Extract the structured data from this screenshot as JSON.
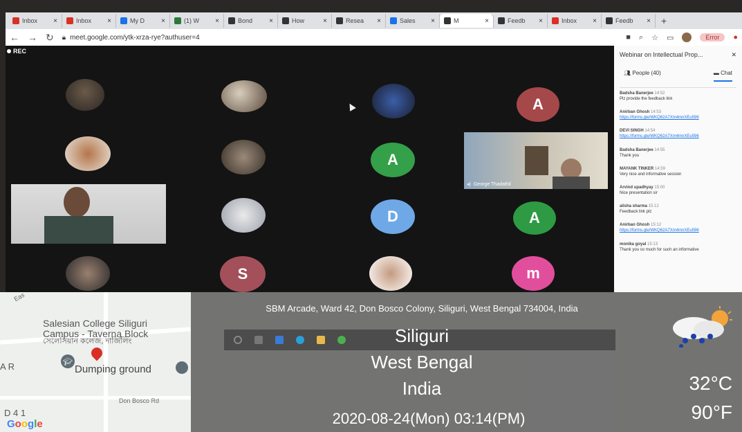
{
  "tabs": [
    {
      "label": "Inbox",
      "icon": "gmail-icon",
      "color": "#d93025"
    },
    {
      "label": "Inbox",
      "icon": "gmail-icon",
      "color": "#d93025"
    },
    {
      "label": "My D",
      "icon": "drive-icon",
      "color": "#1a73e8"
    },
    {
      "label": "(1) W",
      "icon": "whatsapp-icon",
      "color": "#2a7a3a"
    },
    {
      "label": "Bond",
      "icon": "sync-icon",
      "color": "#333333"
    },
    {
      "label": "How",
      "icon": "sync-icon",
      "color": "#333333"
    },
    {
      "label": "Resea",
      "icon": "bank-icon",
      "color": "#333333"
    },
    {
      "label": "Sales",
      "icon": "calendar-icon",
      "color": "#1a73e8"
    },
    {
      "label": "M",
      "icon": "meet-icon",
      "color": "#333333",
      "active": true
    },
    {
      "label": "Feedb",
      "icon": "forms-icon",
      "color": "#333333"
    },
    {
      "label": "Inbox",
      "icon": "gmail-icon",
      "color": "#d93025"
    },
    {
      "label": "Feedb",
      "icon": "forms-icon",
      "color": "#333333"
    }
  ],
  "address": {
    "url": "meet.google.com/ytk-xrza-rye?authuser=4",
    "error_label": "Error"
  },
  "meet": {
    "rec_label": "REC",
    "tiles": [
      {
        "letter": "A",
        "color": "#a5484a"
      },
      {
        "letter": "A",
        "color": "#34a049"
      },
      {
        "letter": "D",
        "color": "#6fa8e6"
      },
      {
        "letter": "A",
        "color": "#2f9a44"
      },
      {
        "letter": "S",
        "color": "#a3505b"
      },
      {
        "letter": "m",
        "color": "#e14f9c"
      }
    ],
    "video_name": "George Thadathil"
  },
  "chat": {
    "title": "Webinar on Intellectual Prop...",
    "people_label": "People (40)",
    "chat_label": "Chat",
    "messages": [
      {
        "sender": "Badsha Banerjee",
        "time": "14:52",
        "text": "Plz provide the feedback link",
        "link": false
      },
      {
        "sender": "Anirban Ghosh",
        "time": "14:53",
        "text": "https://forms.gle/WKQ62A7Xm4mnXEu596",
        "link": true
      },
      {
        "sender": "DEVI SINGH",
        "time": "14:54",
        "text": "https://forms.gle/WKQ62A7Xm4mnXEu596",
        "link": true
      },
      {
        "sender": "Badsha Banerjee",
        "time": "14:55",
        "text": "Thank you",
        "link": false
      },
      {
        "sender": "MAYANK TINKER",
        "time": "14:59",
        "text": "Very nice and informative session",
        "link": false
      },
      {
        "sender": "Arvind upadhyay",
        "time": "15:00",
        "text": "Nice presentation sir",
        "link": false
      },
      {
        "sender": "alisha sharma",
        "time": "15:12",
        "text": "Feedback link plz",
        "link": false
      },
      {
        "sender": "Anirban Ghosh",
        "time": "15:12",
        "text": "https://forms.gle/WKQ62A7Xm4mnXEu596",
        "link": true
      },
      {
        "sender": "monika goyal",
        "time": "15:13",
        "text": "Thank you so much for such an informative",
        "link": false
      }
    ]
  },
  "map": {
    "college": "Salesian College Siliguri Campus - Taverna Block",
    "college_bn": "সেলেসিয়ান কলেজ, দার্জিলিং",
    "dumping": "Dumping ground",
    "road": "Don Bosco Rd",
    "east": "Eas",
    "ar": "A R",
    "d41": "D 4 1",
    "google": "Google"
  },
  "location": {
    "address": "SBM Arcade, Ward 42, Don Bosco Colony, Siliguri, West Bengal 734004, India",
    "city": "Siliguri",
    "state": "West Bengal",
    "country": "India",
    "datetime": "2020-08-24(Mon)   03:14(PM)",
    "temp_c": "32°C",
    "temp_f": "90°F"
  }
}
